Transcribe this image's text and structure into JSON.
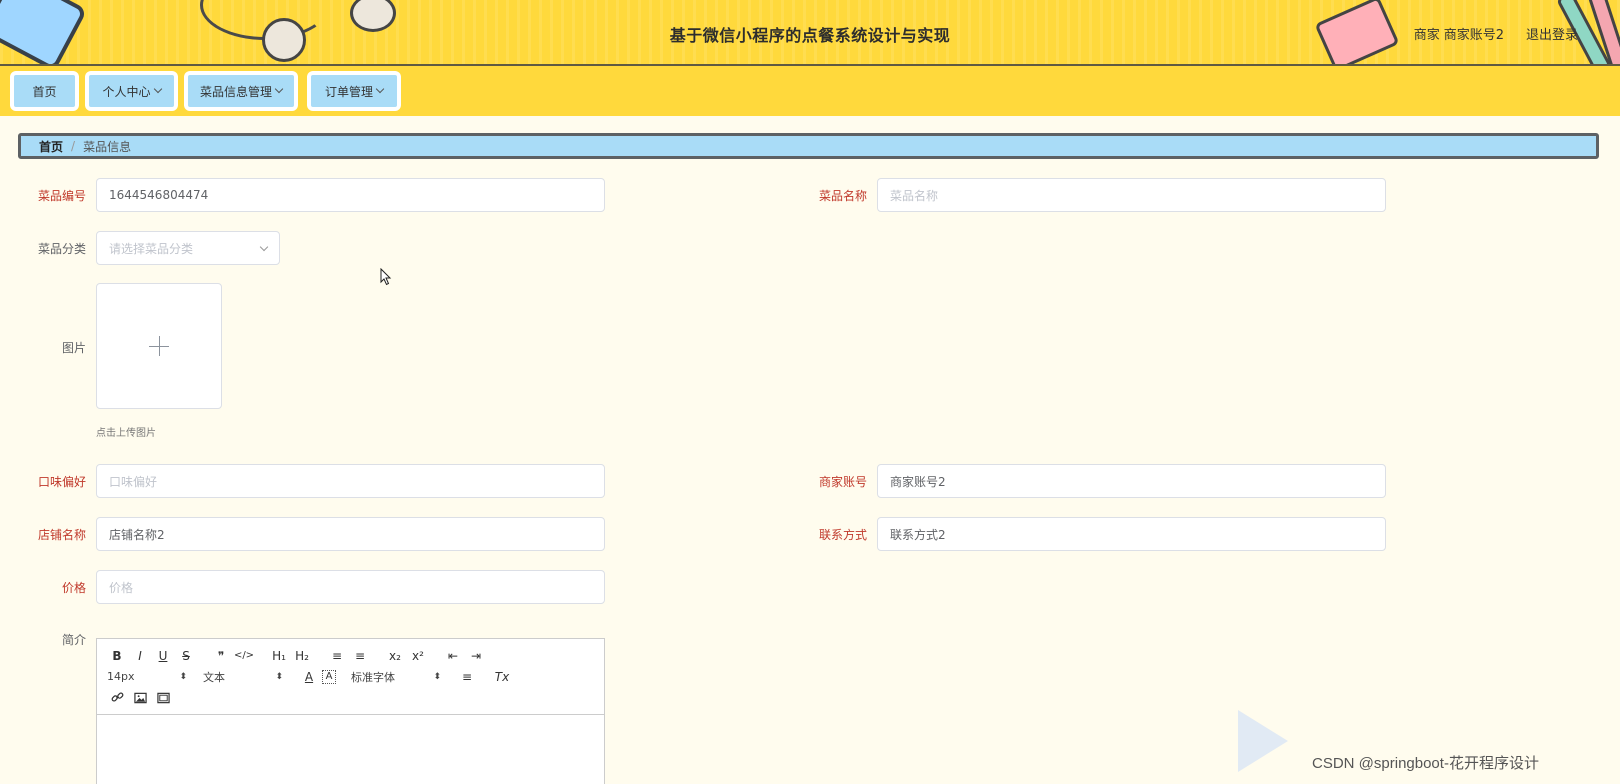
{
  "app": {
    "title": "基于微信小程序的点餐系统设计与实现",
    "user_role": "商家",
    "user_name": "商家账号2",
    "logout_label": "退出登录"
  },
  "nav": {
    "items": [
      {
        "label": "首页",
        "has_dropdown": false
      },
      {
        "label": "个人中心",
        "has_dropdown": true
      },
      {
        "label": "菜品信息管理",
        "has_dropdown": true
      },
      {
        "label": "订单管理",
        "has_dropdown": true
      }
    ]
  },
  "breadcrumb": {
    "home": "首页",
    "separator": "/",
    "current": "菜品信息"
  },
  "form": {
    "dish_no": {
      "label": "菜品编号",
      "value": "1644546804474"
    },
    "dish_name": {
      "label": "菜品名称",
      "placeholder": "菜品名称"
    },
    "category": {
      "label": "菜品分类",
      "placeholder": "请选择菜品分类"
    },
    "image": {
      "label": "图片",
      "tip": "点击上传图片"
    },
    "taste": {
      "label": "口味偏好",
      "placeholder": "口味偏好"
    },
    "merchant_account": {
      "label": "商家账号",
      "value": "商家账号2"
    },
    "shop_name": {
      "label": "店铺名称",
      "value": "店铺名称2"
    },
    "contact": {
      "label": "联系方式",
      "value": "联系方式2"
    },
    "price": {
      "label": "价格",
      "placeholder": "价格"
    },
    "intro": {
      "label": "简介"
    }
  },
  "editor": {
    "row1": {
      "bold": "B",
      "italic": "I",
      "underline": "U",
      "strike": "S",
      "quote": "❞",
      "code": "</>",
      "h1": "H₁",
      "h2": "H₂",
      "ol": "≡",
      "ul": "≡",
      "sub": "x₂",
      "sup": "x²",
      "outdent": "⇤",
      "indent": "⇥"
    },
    "row2": {
      "size": "14px",
      "header": "文本",
      "color": "A",
      "background": "A",
      "font": "标准字体",
      "align": "≡",
      "clean": "Tx"
    }
  },
  "watermark": {
    "text": "CSDN @springboot-花开程序设计"
  },
  "colors": {
    "header_bg": "#ffd93c",
    "nav_button": "#a9dcf7",
    "page_bg": "#fffcee",
    "required_label": "#c0392b"
  }
}
